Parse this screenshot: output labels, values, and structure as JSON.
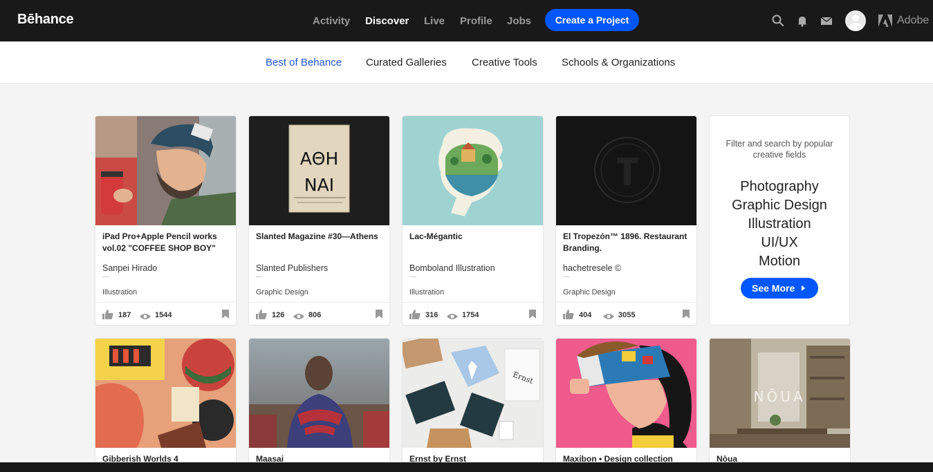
{
  "brand": {
    "logo": "Bēhance",
    "adobe": "Adobe"
  },
  "topnav": {
    "items": [
      "Activity",
      "Discover",
      "Live",
      "Profile",
      "Jobs"
    ],
    "active": "Discover",
    "cta": "Create a Project",
    "icons": [
      "search-icon",
      "bell-icon",
      "mail-icon",
      "avatar",
      "adobe-logo-icon"
    ]
  },
  "subnav": {
    "tabs": [
      "Best of Behance",
      "Curated Galleries",
      "Creative Tools",
      "Schools & Organizations"
    ],
    "active": "Best of Behance"
  },
  "colors": {
    "topbar": "#191919",
    "accent": "#0057ff",
    "active_tab": "#1f57d6"
  },
  "projects": [
    {
      "title": "iPad Pro+Apple Pencil works vol.02 \"COFFEE SHOP BOY\"",
      "owner": "Sanpei Hirado",
      "field": "Illustration",
      "likes": "187",
      "views": "1544"
    },
    {
      "title": "Slanted Magazine #30—Athens",
      "owner": "Slanted Publishers",
      "field": "Graphic Design",
      "likes": "126",
      "views": "806"
    },
    {
      "title": "Lac-Mégantic",
      "owner": "Bomboland Illustration",
      "field": "Illustration",
      "likes": "316",
      "views": "1754"
    },
    {
      "title": "El Tropezón™ 1896. Restaurant Branding.",
      "owner": "hachetresele ©",
      "field": "Graphic Design",
      "likes": "404",
      "views": "3055"
    },
    {
      "title": "Gibberish Worlds 4"
    },
    {
      "title": "Maasai"
    },
    {
      "title": "Ernst by Ernst"
    },
    {
      "title": "Maxibon • Design collection"
    },
    {
      "title": "Nōua"
    }
  ],
  "artwork_text": {
    "athens_cover": "ΑΘΗ ΝΑΙ",
    "nous_sign": "NŌUA",
    "ernst_bag": "Ernst"
  },
  "promo": {
    "caption": "Filter and search by popular creative fields",
    "fields": [
      "Photography",
      "Graphic Design",
      "Illustration",
      "UI/UX",
      "Motion"
    ],
    "button": "See More"
  }
}
